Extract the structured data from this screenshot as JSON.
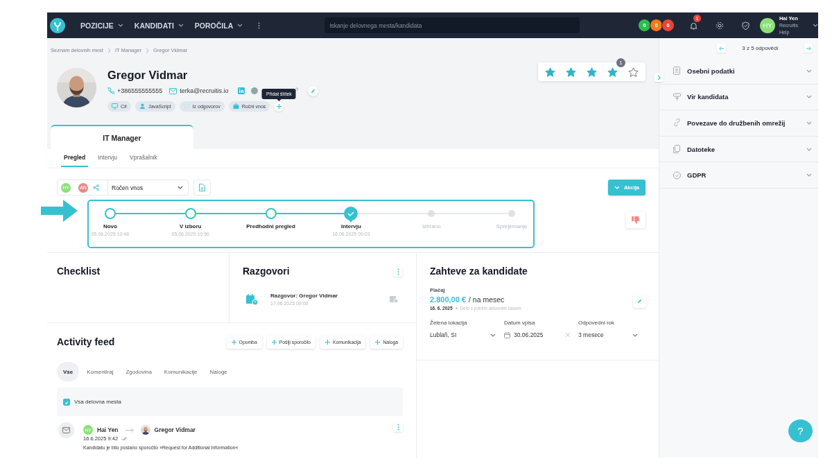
{
  "topbar": {
    "nav": [
      {
        "label": "POZICIJE"
      },
      {
        "label": "KANDIDATI"
      },
      {
        "label": "POROČILA"
      }
    ],
    "search": {
      "placeholder": "Iskanje delovnega mesta/kandidata"
    },
    "counters": [
      {
        "value": "0",
        "color": "#2dbd4e"
      },
      {
        "value": "0",
        "color": "#f07b1c"
      },
      {
        "value": "6",
        "color": "#e8453c"
      }
    ],
    "notifications": "1",
    "user": {
      "initials": "HY",
      "name": "Hai Yen",
      "org": "Recruitis Help"
    }
  },
  "breadcrumbs": [
    "Seznam delovnih mest",
    "IT Manager",
    "Gregor Vidmar"
  ],
  "candidate": {
    "name": "Gregor Vidmar",
    "phone": "+386555555555",
    "email": "terka@recruitis.io",
    "tags": [
      {
        "label": "C#",
        "kind": "screen"
      },
      {
        "label": "JavaScript",
        "kind": "person"
      },
      {
        "label": "Iz odgovorov",
        "kind": "chat"
      },
      {
        "label": "Ročni vnos",
        "kind": "briefcase"
      }
    ],
    "add_tag_tooltip": "Přidat štítek",
    "rating": {
      "stars": 4,
      "count": "1"
    }
  },
  "job_tabs": [
    {
      "label": "IT Manager",
      "selected": true
    }
  ],
  "sub_tabs": [
    {
      "label": "Pregled",
      "selected": true
    },
    {
      "label": "Intervju",
      "selected": false
    },
    {
      "label": "Vprašalnik",
      "selected": false
    }
  ],
  "pipeline": {
    "owners": [
      {
        "initials": "HY",
        "color": "#8be07a"
      },
      {
        "initials": "AN",
        "color": "#e88a8a"
      }
    ],
    "source": "Ročen vnos",
    "action": "Akcija",
    "steps": [
      {
        "label": "Novo",
        "date": "05.06.2025 10:48",
        "kind": "done"
      },
      {
        "label": "V izboru",
        "date": "05.06.2025 10:56",
        "kind": "done"
      },
      {
        "label": "Predhodni pregled",
        "kind": "done"
      },
      {
        "label": "Intervju",
        "date": "16.06.2025 09:03",
        "kind": "current"
      },
      {
        "label": "Izbrano",
        "kind": "pending"
      },
      {
        "label": "Sprejemanje",
        "kind": "pending"
      }
    ]
  },
  "checklist": {
    "title": "Checklist"
  },
  "interviews": {
    "title": "Razgovori",
    "items": [
      {
        "title": "Razgovor: Gregor Vidmar",
        "date": "17.06.2025 09:00"
      }
    ]
  },
  "activity": {
    "title": "Activity feed",
    "buttons": [
      "Opomba",
      "Pošlji sporočilo",
      "Komunikacija",
      "Naloga"
    ],
    "filters": [
      {
        "label": "Vse",
        "selected": true
      },
      {
        "label": "Komentiraj",
        "selected": false
      },
      {
        "label": "Zgodovina",
        "selected": false
      },
      {
        "label": "Komunikacije",
        "selected": false
      },
      {
        "label": "Naloge",
        "selected": false
      }
    ],
    "all_positions": {
      "label": "Vsa delovna mesta",
      "checked": true
    },
    "entries": [
      {
        "from": {
          "initials": "HY",
          "name": "Hai Yen"
        },
        "to": {
          "name": "Gregor Vidmar"
        },
        "time": "16.6.2025 9:42",
        "text": "Kandidatu je bilo poslano sporočilo »Request for Additional Information«"
      }
    ]
  },
  "requirements": {
    "title": "Zahteve za kandidate",
    "salary_label": "Plačaj",
    "salary_value": "2.800,00 €",
    "salary_unit": "/ na mesec",
    "salary_date": "16. 6. 2025",
    "salary_type": "Delo s polnim delovnim časom",
    "fields": [
      {
        "label": "Želena lokacija",
        "value": "Lublaň, SI",
        "kind": "select"
      },
      {
        "label": "Datum vpisa",
        "value": "30.06.2025",
        "kind": "date"
      },
      {
        "label": "Odpovedni rok",
        "value": "3 mesece",
        "kind": "select"
      }
    ]
  },
  "side_panel": {
    "pager": "3 z 5 odpovědí",
    "sections": [
      {
        "label": "Osebni podatki",
        "kind": "contact",
        "expanded": false
      },
      {
        "label": "Vir kandidata",
        "kind": "source",
        "expanded": false
      },
      {
        "label": "Povezave do družbenih omrežij",
        "kind": "link",
        "expanded": false
      },
      {
        "label": "Datoteke",
        "kind": "files",
        "expanded": false
      },
      {
        "label": "GDPR",
        "kind": "check",
        "expanded": false
      }
    ]
  },
  "help": "?"
}
